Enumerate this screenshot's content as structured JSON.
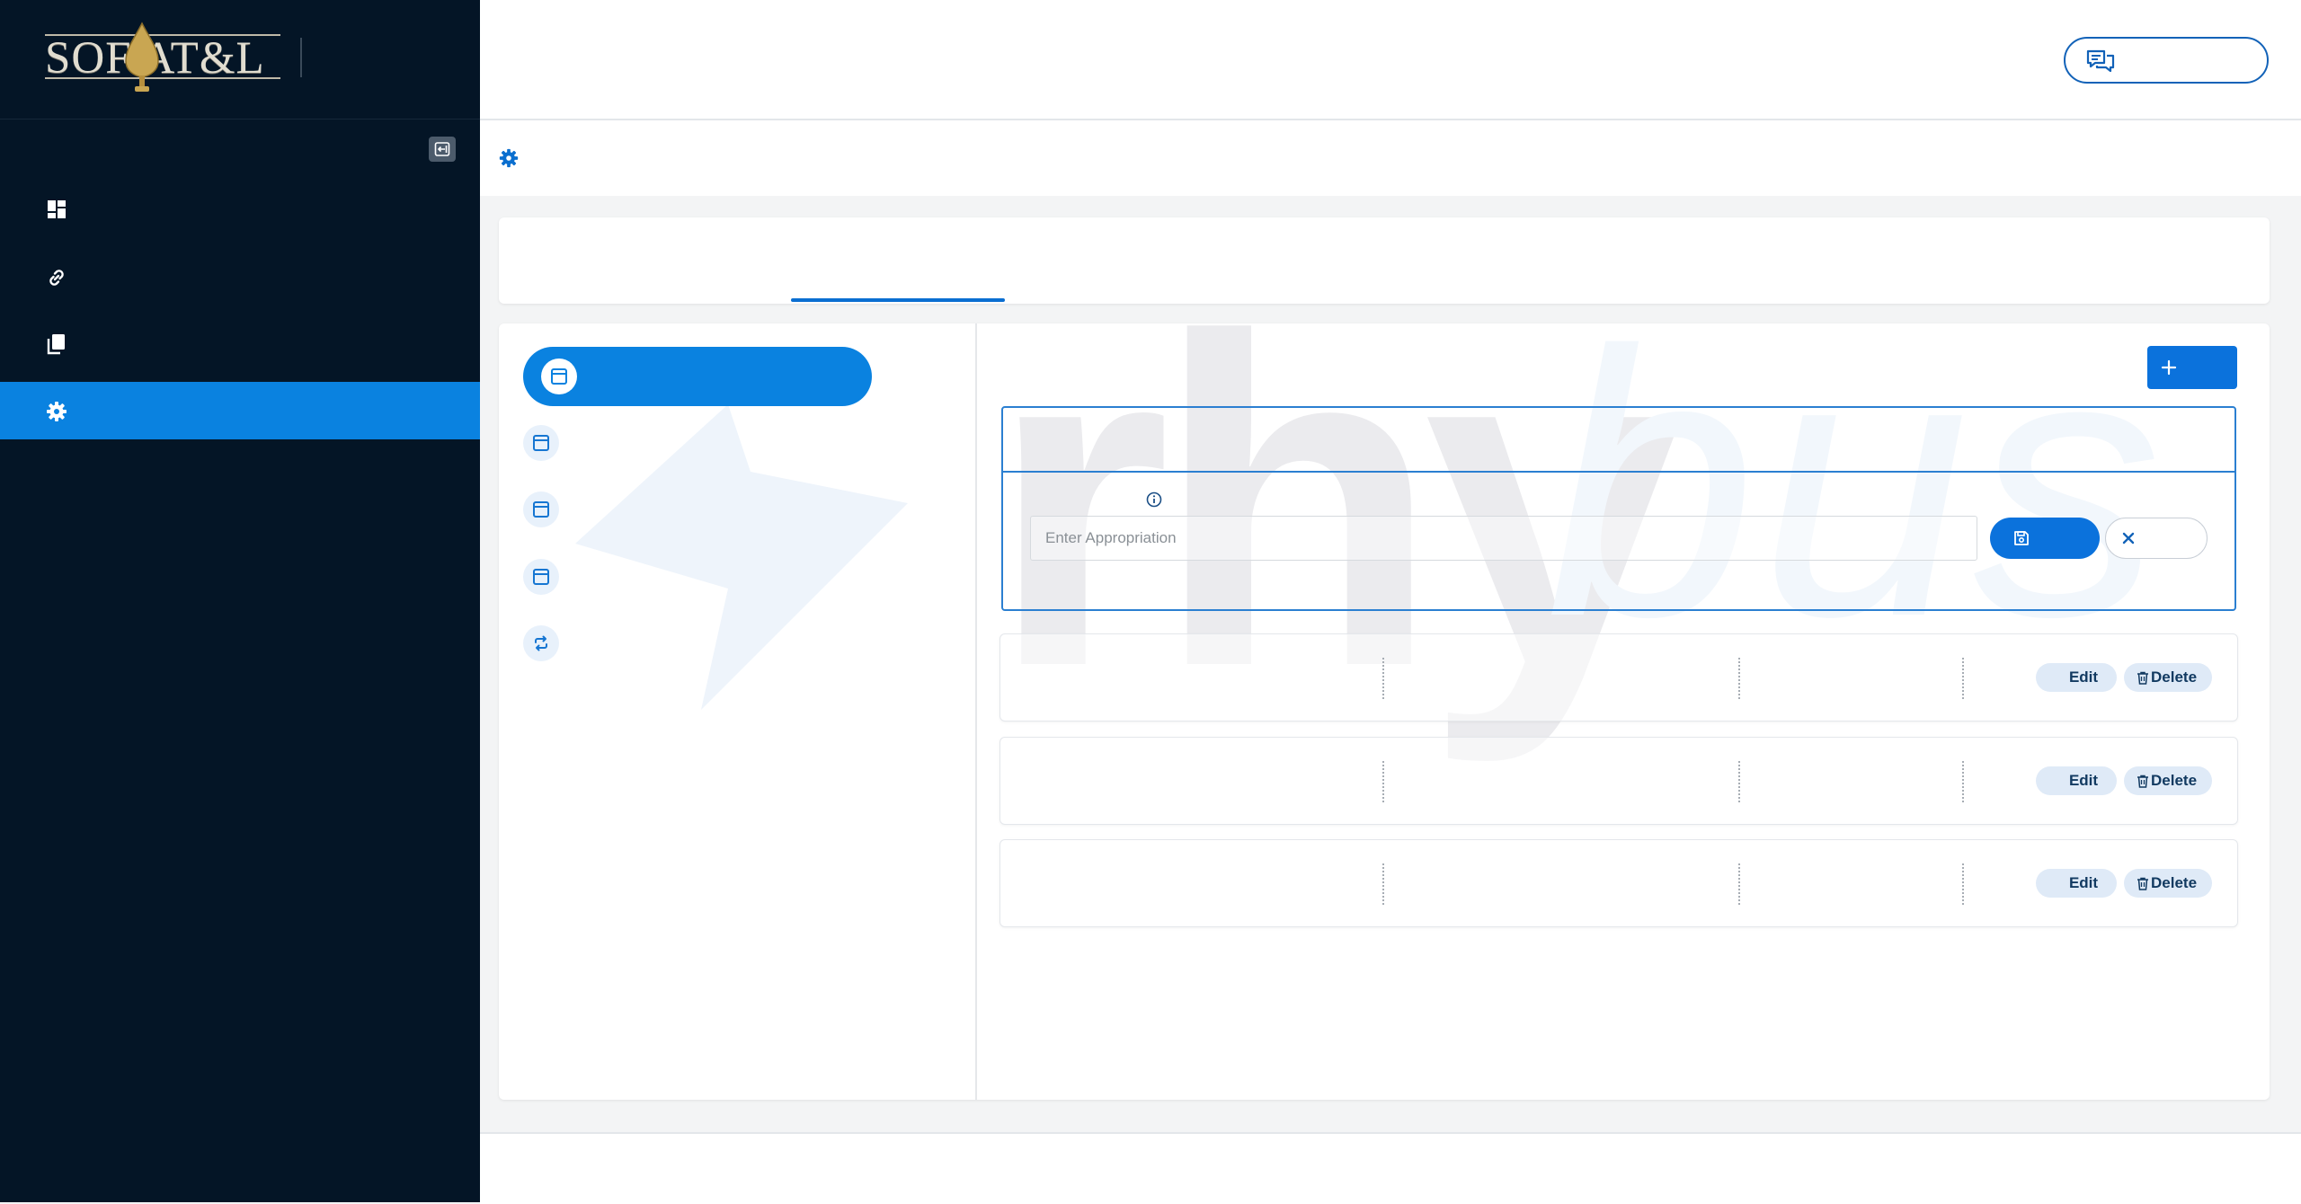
{
  "brand": {
    "logo_text": "SOF AT&L"
  },
  "sidebar": {
    "items": [
      {
        "icon": "dashboard-icon",
        "active": false
      },
      {
        "icon": "link-icon",
        "active": false
      },
      {
        "icon": "documents-icon",
        "active": false
      },
      {
        "icon": "gear-icon",
        "active": true
      }
    ]
  },
  "header": {
    "chat_icon": "chat-bubbles-icon"
  },
  "config": {
    "side_tabs": [
      {
        "icon": "window-icon",
        "active": true
      },
      {
        "icon": "window-icon",
        "active": false
      },
      {
        "icon": "window-icon",
        "active": false
      },
      {
        "icon": "window-icon",
        "active": false
      },
      {
        "icon": "sync-icon",
        "active": false
      }
    ],
    "form": {
      "input_placeholder": "Enter Appropriation",
      "input_value": ""
    },
    "rows": [
      {
        "edit_label": "Edit",
        "delete_label": "Delete"
      },
      {
        "edit_label": "Edit",
        "delete_label": "Delete"
      },
      {
        "edit_label": "Edit",
        "delete_label": "Delete"
      }
    ]
  },
  "watermark": {
    "text_dark": "rhy",
    "text_light": "bus"
  },
  "colors": {
    "sidebar_bg": "#041526",
    "accent": "#0a82e0",
    "primary_button": "#0b72dc",
    "chip_bg": "#dfeaf7"
  }
}
